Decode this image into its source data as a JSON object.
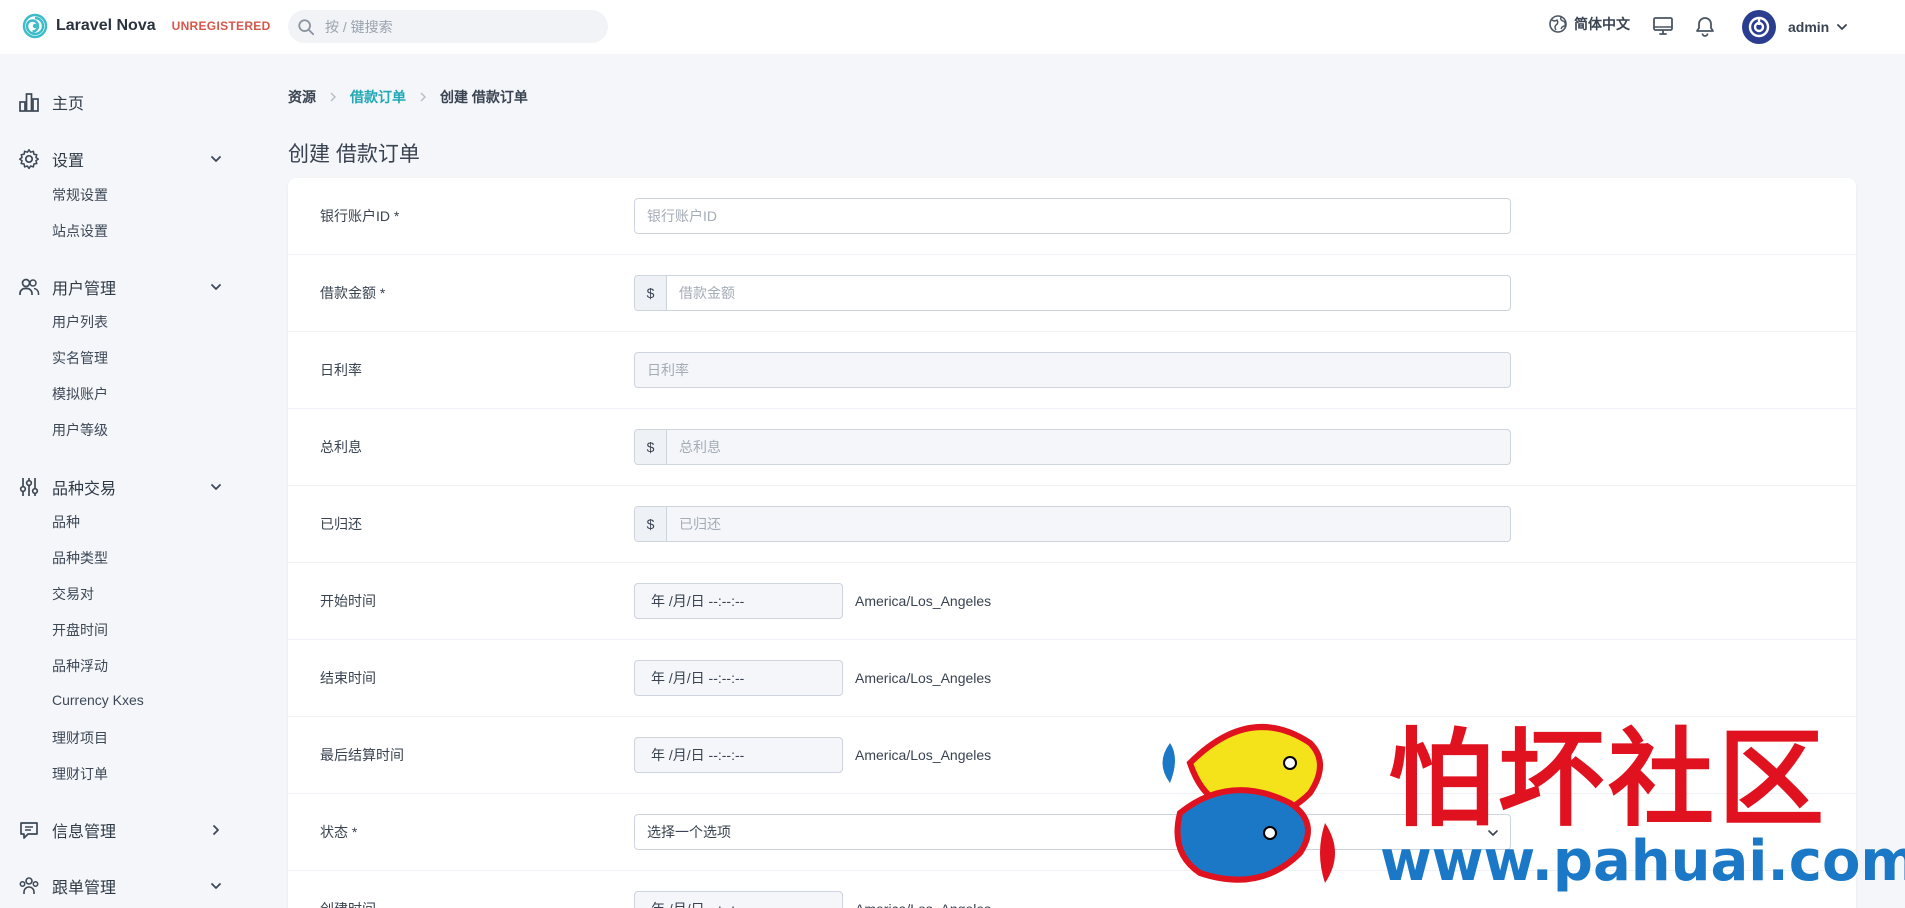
{
  "header": {
    "brand_name": "Laravel Nova",
    "brand_badge": "UNREGISTERED",
    "search_placeholder": "按 / 键搜索",
    "language": "简体中文",
    "user_name": "admin"
  },
  "sidebar": {
    "home": "主页",
    "groups": [
      {
        "label": "设置",
        "items": [
          "常规设置",
          "站点设置"
        ]
      },
      {
        "label": "用户管理",
        "items": [
          "用户列表",
          "实名管理",
          "模拟账户",
          "用户等级"
        ]
      },
      {
        "label": "品种交易",
        "items": [
          "品种",
          "品种类型",
          "交易对",
          "开盘时间",
          "品种浮动",
          "Currency Kxes",
          "理财项目",
          "理财订单"
        ]
      },
      {
        "label": "信息管理",
        "items": []
      },
      {
        "label": "跟单管理",
        "items": []
      }
    ]
  },
  "breadcrumb": [
    "资源",
    "借款订单",
    "创建 借款订单"
  ],
  "page_title": "创建 借款订单",
  "form": {
    "currency_symbol": "$",
    "timezone": "America/Los_Angeles",
    "datetime_placeholder": "年 /月/日  --:--:--",
    "fields": [
      {
        "label": "银行账户ID *",
        "placeholder": "银行账户ID"
      },
      {
        "label": "借款金额 *",
        "placeholder": "借款金额"
      },
      {
        "label": "日利率",
        "placeholder": "日利率"
      },
      {
        "label": "总利息",
        "placeholder": "总利息"
      },
      {
        "label": "已归还",
        "placeholder": "已归还"
      },
      {
        "label": "开始时间"
      },
      {
        "label": "结束时间"
      },
      {
        "label": "最后结算时间"
      },
      {
        "label": "状态 *",
        "placeholder": "选择一个选项"
      },
      {
        "label": "创建时间"
      }
    ]
  },
  "watermark": {
    "text": "怕坏社区",
    "url": "www.pahuai.com"
  },
  "colors": {
    "accent": "#20a8b5",
    "badge": "#d6574c",
    "watermark_red": "#e1121f",
    "watermark_blue": "#1b78c7"
  }
}
